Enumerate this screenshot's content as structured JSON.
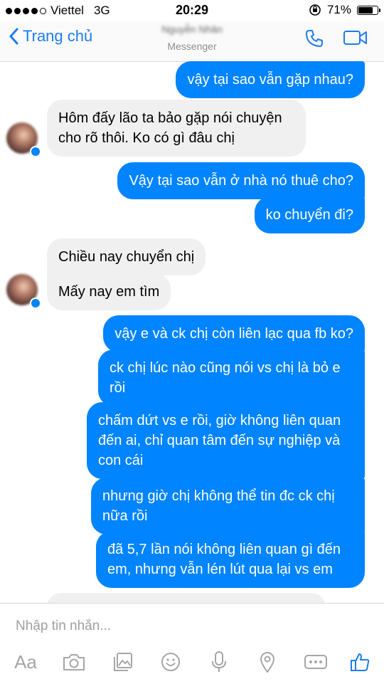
{
  "status_bar": {
    "carrier": "Viettel",
    "network": "3G",
    "time": "20:29",
    "battery": "71%",
    "battery_level": 0.71,
    "signal_bars_filled": 4,
    "signal_bars_total": 5
  },
  "nav": {
    "back_label": "Trang chủ",
    "contact_name": "Nguyễn Nhân",
    "subtitle": "Messenger",
    "accent": "#1d7cf2"
  },
  "messages": [
    {
      "side": "out",
      "text": "vậy tại sao vẫn gặp nhau?"
    },
    {
      "side": "in",
      "text": "Hôm đấy lão ta bảo gặp nói chuyện cho rõ thôi. Ko có gì đâu chị"
    },
    {
      "side": "out",
      "text": "Vậy tại sao vẫn ở nhà nó thuê cho?"
    },
    {
      "side": "out",
      "text": "ko chuyển đi?"
    },
    {
      "side": "in",
      "text": "Chiều nay chuyển chị"
    },
    {
      "side": "in",
      "text": "Mấy nay em tìm"
    },
    {
      "side": "out",
      "text": "vậy e và ck chị còn liên lạc qua fb ko?"
    },
    {
      "side": "out",
      "text": "ck chị lúc nào cũng nói vs chị là bỏ e rồi"
    },
    {
      "side": "out",
      "text": "chấm dứt vs e rồi, giờ không liên quan đến ai, chỉ quan tâm đến sự nghiệp và con cái"
    },
    {
      "side": "out",
      "text": "nhưng giờ chị không thể tin đc ck chị nữa rồi"
    },
    {
      "side": "out",
      "text": "đã 5,7 lần nói không liên quan gì đến em, nhưng vẫn lén lút qua lại vs em"
    }
  ],
  "composer": {
    "placeholder": "Nhập tin nhắn...",
    "aa_label": "Aa"
  },
  "colors": {
    "outgoing_bubble": "#0084ff",
    "incoming_bubble": "#f1f0f0",
    "toolbar_icon": "#a6a6a6",
    "like_icon": "#1d7cf2"
  }
}
